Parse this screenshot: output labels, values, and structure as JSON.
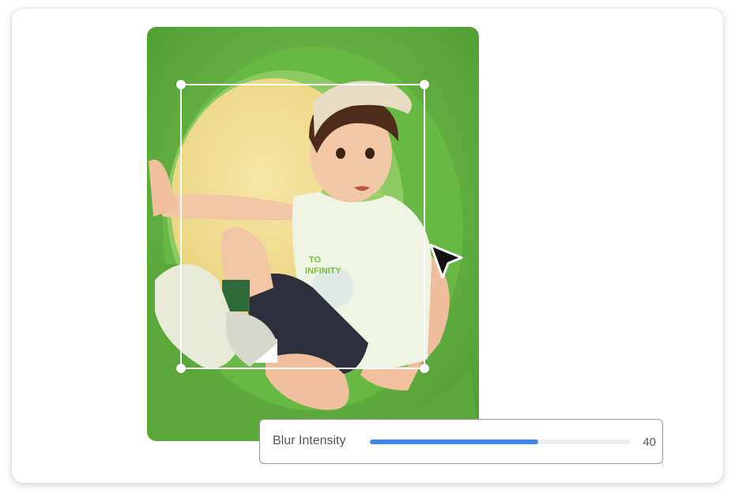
{
  "photo": {
    "image_name": "child-in-green-tunnel-photo",
    "colors": {
      "tunnel_green": "#5cae3a",
      "tunnel_inner": "#f1df93"
    }
  },
  "selection_box": {
    "handles": [
      "top-left",
      "top-right",
      "bottom-left",
      "bottom-right"
    ]
  },
  "cursor": {
    "icon": "arrow-cursor-icon"
  },
  "blur_control": {
    "label": "Blur Intensity",
    "value": "40",
    "fill_fraction": 0.645,
    "accent_color": "#3f86e8"
  }
}
